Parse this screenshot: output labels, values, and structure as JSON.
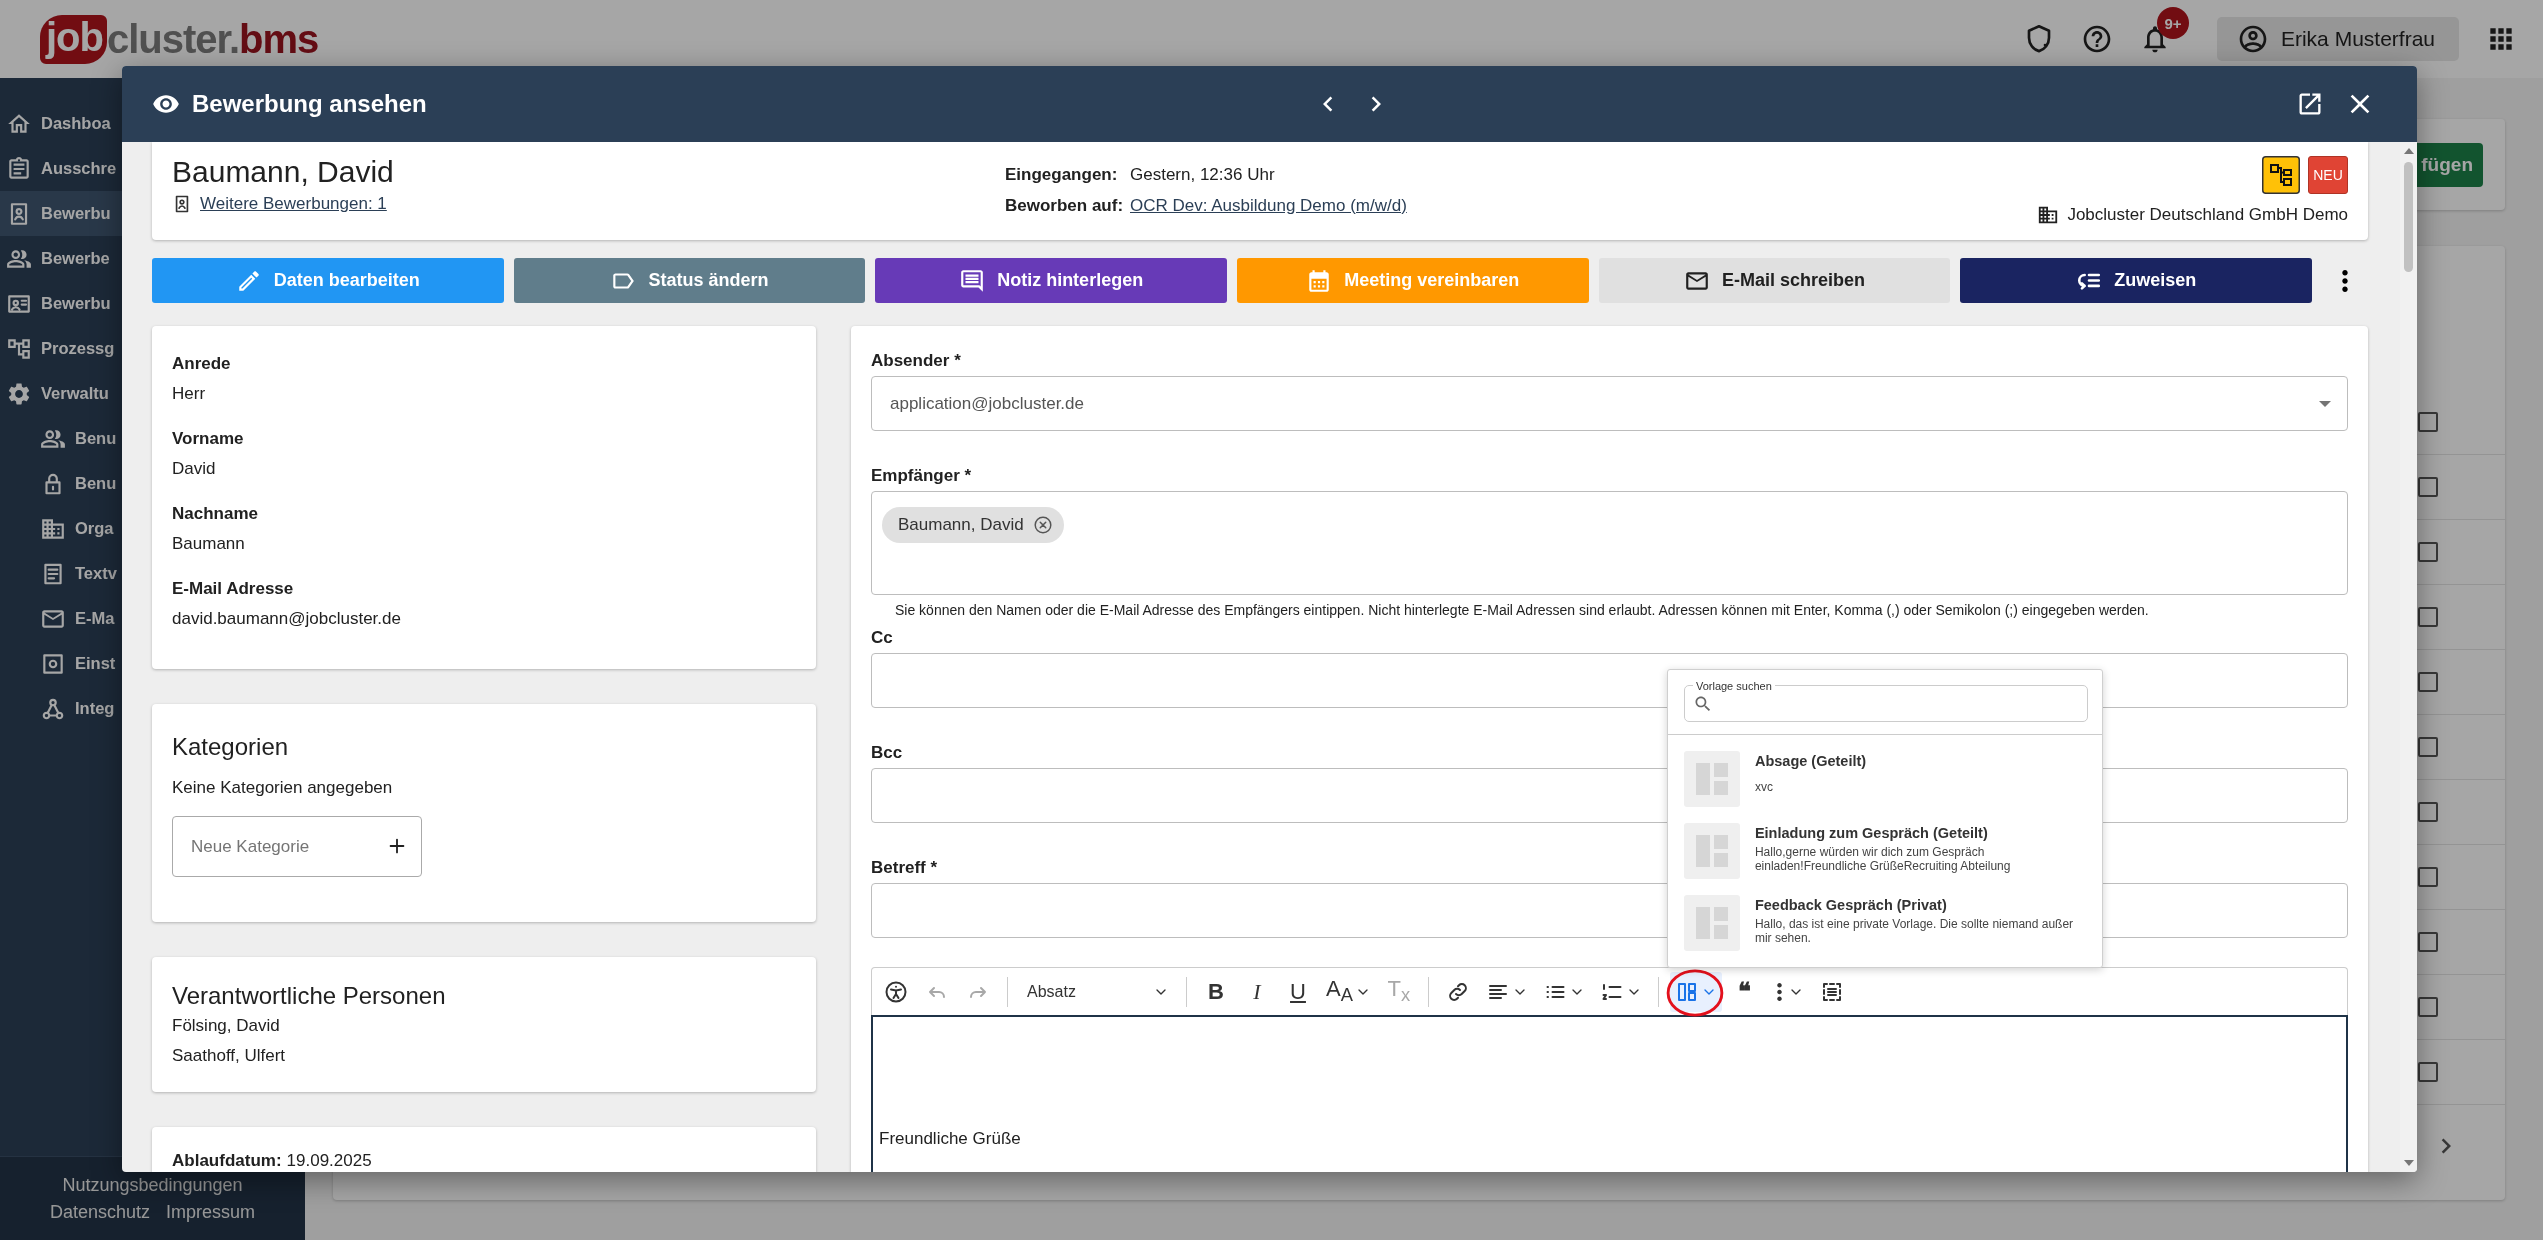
{
  "app": {
    "logo": {
      "part_1": "job",
      "part_2": "cluster.",
      "part_3": "bms"
    },
    "notifications_badge": "9+",
    "user": "Erika Musterfrau"
  },
  "sidebar": {
    "items": [
      {
        "label": "Dashboa",
        "selected": false
      },
      {
        "label": "Ausschre",
        "selected": false
      },
      {
        "label": "Bewerbu",
        "selected": true
      },
      {
        "label": "Bewerbe",
        "selected": false
      },
      {
        "label": "Bewerbu",
        "selected": false
      },
      {
        "label": "Prozessg",
        "selected": false
      },
      {
        "label": "Verwaltu",
        "selected": false,
        "children": [
          {
            "label": "Benu",
            "selected": false
          },
          {
            "label": "Benu",
            "selected": false
          },
          {
            "label": "Orga",
            "selected": false
          },
          {
            "label": "Textv",
            "selected": false
          },
          {
            "label": "E-Ma",
            "selected": false
          },
          {
            "label": "Einst",
            "selected": false
          },
          {
            "label": "Integ",
            "selected": false
          }
        ]
      }
    ],
    "footer": [
      "Nutzungsbedingungen",
      "Datenschutz",
      "Impressum"
    ]
  },
  "background": {
    "action_button": "fügen",
    "rows": [
      {
        "checked": false
      },
      {
        "checked": false
      },
      {
        "checked": false
      },
      {
        "checked": false
      },
      {
        "checked": false
      },
      {
        "checked": false
      },
      {
        "checked": false
      },
      {
        "checked": false
      },
      {
        "checked": false
      },
      {
        "checked": false
      },
      {
        "checked": false
      }
    ]
  },
  "dialog": {
    "title": "Bewerbung ansehen",
    "applicant": {
      "name": "Baumann, David",
      "other_applications": "Weitere Bewerbungen: 1",
      "received_label": "Eingegangen:",
      "received": "Gestern, 12:36 Uhr",
      "applied_label": "Beworben auf:",
      "applied_for": "OCR Dev: Ausbildung Demo (m/w/d)",
      "status_badge": "NEU",
      "company": "Jobcluster Deutschland GmbH Demo"
    },
    "actions": [
      {
        "label": "Daten bearbeiten",
        "color": "#2196f3"
      },
      {
        "label": "Status ändern",
        "color": "#607d8b"
      },
      {
        "label": "Notiz hinterlegen",
        "color": "#673ab7"
      },
      {
        "label": "Meeting vereinbaren",
        "color": "#ff9800"
      },
      {
        "label": "E-Mail schreiben",
        "color": "#e0e0e0"
      },
      {
        "label": "Zuweisen",
        "color": "#1a2461"
      }
    ],
    "details": [
      {
        "label": "Anrede",
        "value": "Herr"
      },
      {
        "label": "Vorname",
        "value": "David"
      },
      {
        "label": "Nachname",
        "value": "Baumann"
      },
      {
        "label": "E-Mail Adresse",
        "value": "david.baumann@jobcluster.de"
      }
    ],
    "categories": {
      "title": "Kategorien",
      "empty": "Keine Kategorien angegeben",
      "placeholder": "Neue Kategorie"
    },
    "responsible": {
      "title": "Verantwortliche Personen",
      "people": [
        "Fölsing, David",
        "Saathoff, Ulfert"
      ]
    },
    "expiry": {
      "label": "Ablaufdatum:",
      "value": "19.09.2025"
    },
    "email": {
      "sender_label": "Absender *",
      "sender": "application@jobcluster.de",
      "recipients_label": "Empfänger *",
      "recipients": [
        "Baumann, David"
      ],
      "recipients_hint": "Sie können den Namen oder die E-Mail Adresse des Empfängers eintippen. Nicht hinterlegte E-Mail Adressen sind erlaubt. Adressen können mit Enter, Komma (,) oder Semikolon (;) eingegeben werden.",
      "cc_label": "Cc",
      "bcc_label": "Bcc",
      "subject_label": "Betreff *",
      "toolbar": [
        {
          "kind": "accessibility",
          "disabled": false,
          "active": false,
          "circled": false
        },
        {
          "kind": "undo",
          "disabled": true,
          "active": false,
          "circled": false
        },
        {
          "kind": "redo",
          "disabled": true,
          "active": false,
          "circled": false
        },
        {
          "kind": "separator"
        },
        {
          "kind": "block_format",
          "label": "Absatz",
          "disabled": false,
          "active": false,
          "circled": false
        },
        {
          "kind": "separator"
        },
        {
          "kind": "bold",
          "label": "B",
          "disabled": false,
          "active": false,
          "circled": false
        },
        {
          "kind": "italic",
          "label": "I",
          "disabled": false,
          "active": false,
          "circled": false
        },
        {
          "kind": "underline",
          "label": "U",
          "disabled": false,
          "active": false,
          "circled": false
        },
        {
          "kind": "font_size",
          "label": "A$_{A}$",
          "disabled": false,
          "active": false,
          "circled": false
        },
        {
          "kind": "clear_format",
          "label": "T$_{x}$",
          "disabled": true,
          "active": false,
          "circled": false
        },
        {
          "kind": "separator"
        },
        {
          "kind": "link",
          "disabled": false,
          "active": false,
          "circled": false
        },
        {
          "kind": "align",
          "disabled": false,
          "active": false,
          "circled": false
        },
        {
          "kind": "bullet_list",
          "disabled": false,
          "active": false,
          "circled": false
        },
        {
          "kind": "numbered_list",
          "disabled": false,
          "active": false,
          "circled": false
        },
        {
          "kind": "separator"
        },
        {
          "kind": "template",
          "disabled": false,
          "active": true,
          "circled": true
        },
        {
          "kind": "quote",
          "label": "❝",
          "disabled": false,
          "active": false,
          "circled": false
        },
        {
          "kind": "more",
          "disabled": false,
          "active": false,
          "circled": false
        },
        {
          "kind": "source",
          "disabled": false,
          "active": false,
          "circled": false
        }
      ],
      "body": "Freundliche Grüße",
      "templates": {
        "search_label": "Vorlage suchen",
        "items": [
          {
            "title": "Absage (Geteilt)",
            "description": "xvc"
          },
          {
            "title": "Einladung zum Gespräch (Geteilt)",
            "description": "Hallo,gerne würden wir dich zum Gespräch einladen!Freundliche GrüßeRecruiting Abteilung"
          },
          {
            "title": "Feedback Gespräch (Privat)",
            "description": "Hallo, das ist eine private Vorlage. Die sollte niemand außer mir sehen."
          }
        ]
      }
    }
  }
}
